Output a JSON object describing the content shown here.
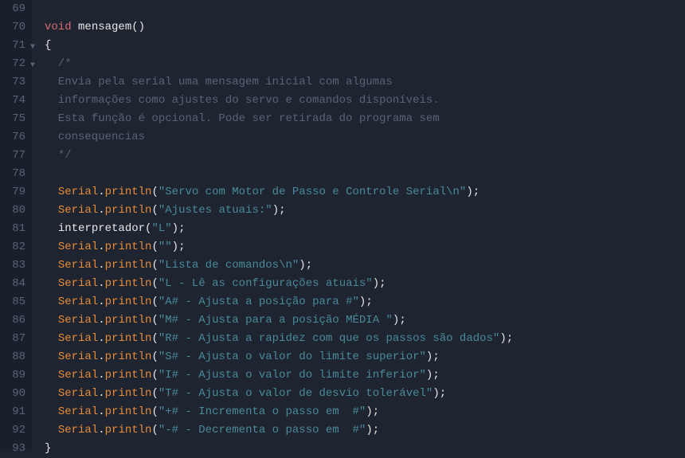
{
  "lines": {
    "l69": "69",
    "l70": "70",
    "l71": "71",
    "l72": "72",
    "l73": "73",
    "l74": "74",
    "l75": "75",
    "l76": "76",
    "l77": "77",
    "l78": "78",
    "l79": "79",
    "l80": "80",
    "l81": "81",
    "l82": "82",
    "l83": "83",
    "l84": "84",
    "l85": "85",
    "l86": "86",
    "l87": "87",
    "l88": "88",
    "l89": "89",
    "l90": "90",
    "l91": "91",
    "l92": "92",
    "l93": "93"
  },
  "code": {
    "void_kw": "void",
    "fn_name": "mensagem",
    "parens": "()",
    "open_brace": "{",
    "close_brace": "}",
    "comment_open": "  /*",
    "comment_l1": "  Envia pela serial uma mensagem inicial com algumas",
    "comment_l2": "  informações como ajustes do servo e comandos disponíveis.",
    "comment_l3": "  Esta função é opcional. Pode ser retirada do programa sem",
    "comment_l4": "  consequencias",
    "comment_close": "  */",
    "serial": "Serial",
    "dot": ".",
    "println": "println",
    "lparen": "(",
    "rparen": ")",
    "semi": ";",
    "interpretador": "interpretador",
    "s79": "\"Servo com Motor de Passo e Controle Serial\\n\"",
    "s80": "\"Ajustes atuais:\"",
    "s81": "\"L\"",
    "s82": "\"\"",
    "s83": "\"Lista de comandos\\n\"",
    "s84": "\"L - Lê as configurações atuais\"",
    "s85": "\"A# - Ajusta a posição para #\"",
    "s86": "\"M# - Ajusta para a posição MÉDIA \"",
    "s87": "\"R# - Ajusta a rapidez com que os passos são dados\"",
    "s88": "\"S# - Ajusta o valor do limite superior\"",
    "s89": "\"I# - Ajusta o valor do limite inferior\"",
    "s90": "\"T# - Ajusta o valor de desvio tolerável\"",
    "s91": "\"+# - Incrementa o passo em  #\"",
    "s92": "\"-# - Decrementa o passo em  #\""
  },
  "fold_marker": "▼"
}
